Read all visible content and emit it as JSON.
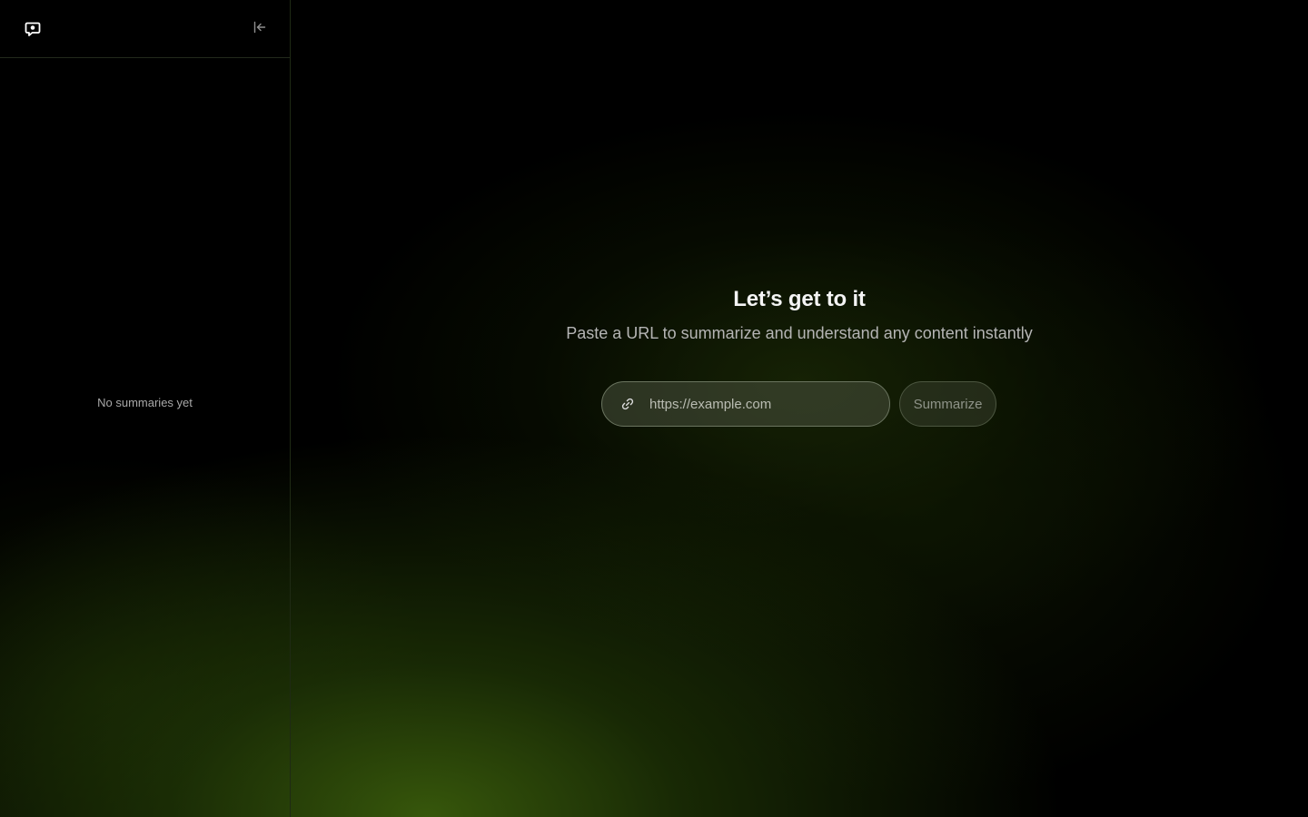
{
  "sidebar": {
    "logo_icon": "chat-bubble-icon",
    "collapse_icon": "collapse-left-icon",
    "empty_message": "No summaries yet"
  },
  "main": {
    "title": "Let’s get to it",
    "subtitle": "Paste a URL to summarize and understand any content instantly",
    "url_input": {
      "value": "",
      "placeholder": "https://example.com",
      "icon": "link-icon"
    },
    "submit_label": "Summarize"
  },
  "colors": {
    "background": "#000000",
    "accent_glow": "#3a5c0c",
    "text_primary": "#f4f4f4",
    "text_secondary": "#b5b5b5"
  }
}
